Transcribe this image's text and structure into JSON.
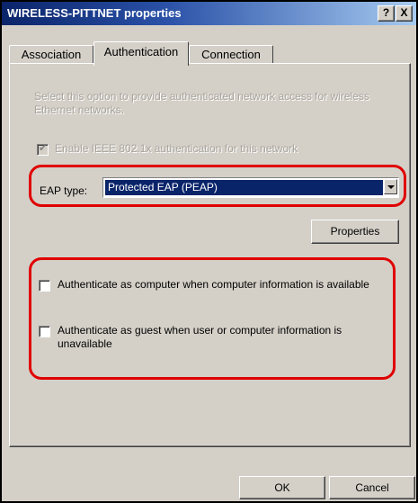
{
  "window": {
    "title": "WIRELESS-PITTNET properties",
    "help_button": "?",
    "close_button": "X"
  },
  "tabs": [
    {
      "label": "Association",
      "selected": false
    },
    {
      "label": "Authentication",
      "selected": true
    },
    {
      "label": "Connection",
      "selected": false
    }
  ],
  "authentication": {
    "description": "Select this option to provide authenticated network access for wireless Ethernet networks.",
    "enable_8021x": {
      "label": "Enable IEEE 802.1x authentication for this network",
      "checked": true,
      "disabled": true
    },
    "eap_type_label": "EAP type:",
    "eap_type_value": "Protected EAP (PEAP)",
    "properties_button": "Properties",
    "auth_as_computer": {
      "label": "Authenticate as computer when computer information is available",
      "checked": false
    },
    "auth_as_guest": {
      "label": "Authenticate as guest when user or computer information is unavailable",
      "checked": false
    }
  },
  "footer": {
    "ok_button": "OK",
    "cancel_button": "Cancel"
  },
  "colors": {
    "titlebar_start": "#0a246a",
    "dialog_face": "#d4d0c8",
    "selection": "#0a246a",
    "highlight_annotation": "#e00000"
  }
}
